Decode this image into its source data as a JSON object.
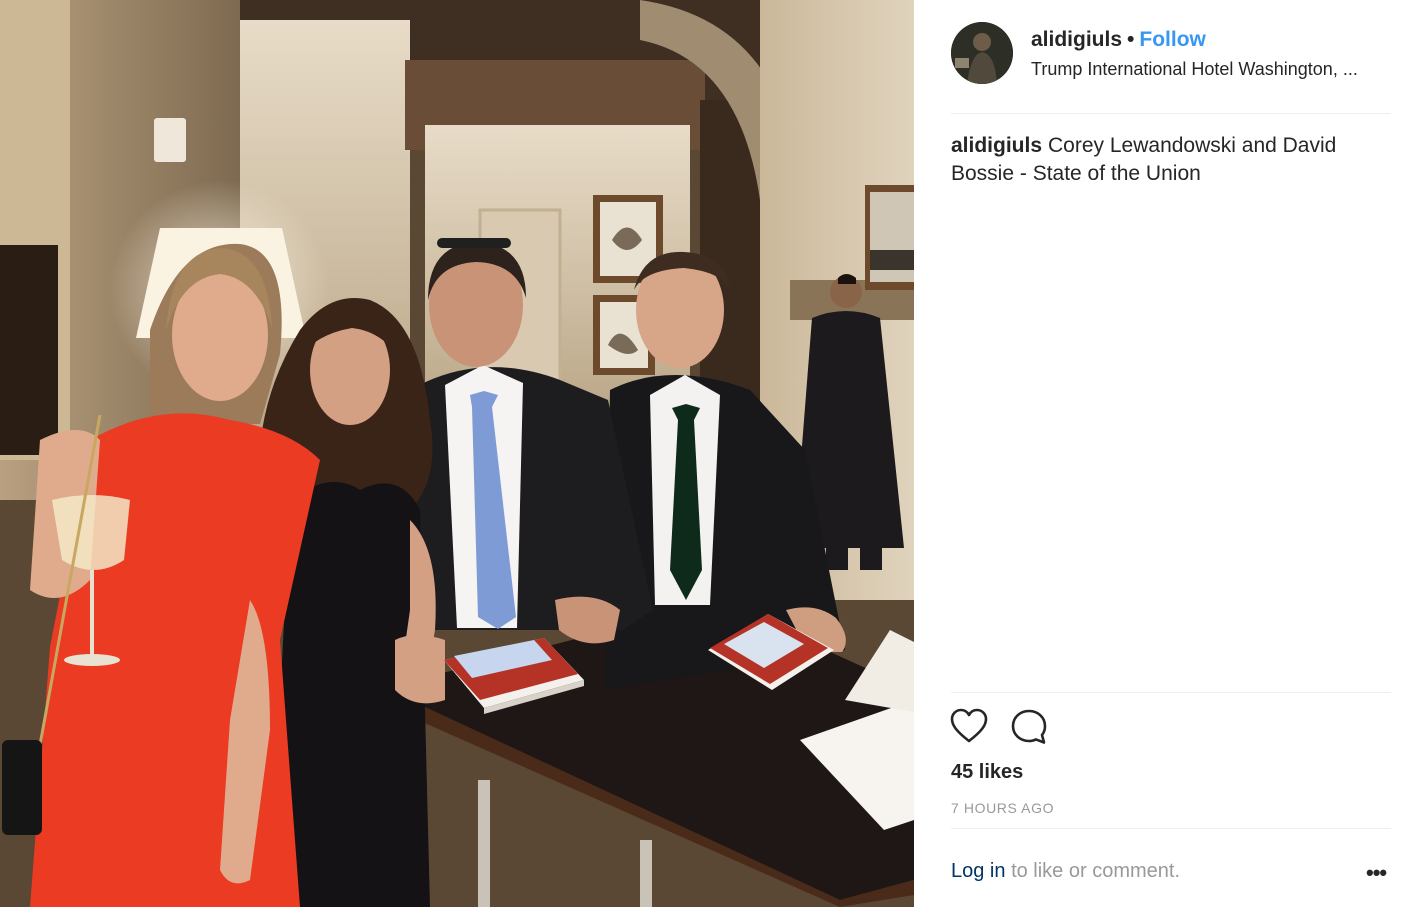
{
  "post": {
    "photo_icon": "photo",
    "author": {
      "username": "alidigiuls",
      "avatar_icon": "avatar",
      "follow_label": "Follow",
      "separator": "•"
    },
    "location": "Trump International Hotel Washington, ...",
    "caption": {
      "username": "alidigiuls",
      "text": "Corey Lewandowski and David Bossie - State of the Union"
    },
    "actions": {
      "like_icon": "heart-icon",
      "comment_icon": "comment-icon"
    },
    "likes": "45 likes",
    "timestamp": "7 HOURS AGO",
    "login_prompt": {
      "link_label": "Log in",
      "rest_text": "to like or comment."
    },
    "more_label": "•••"
  }
}
